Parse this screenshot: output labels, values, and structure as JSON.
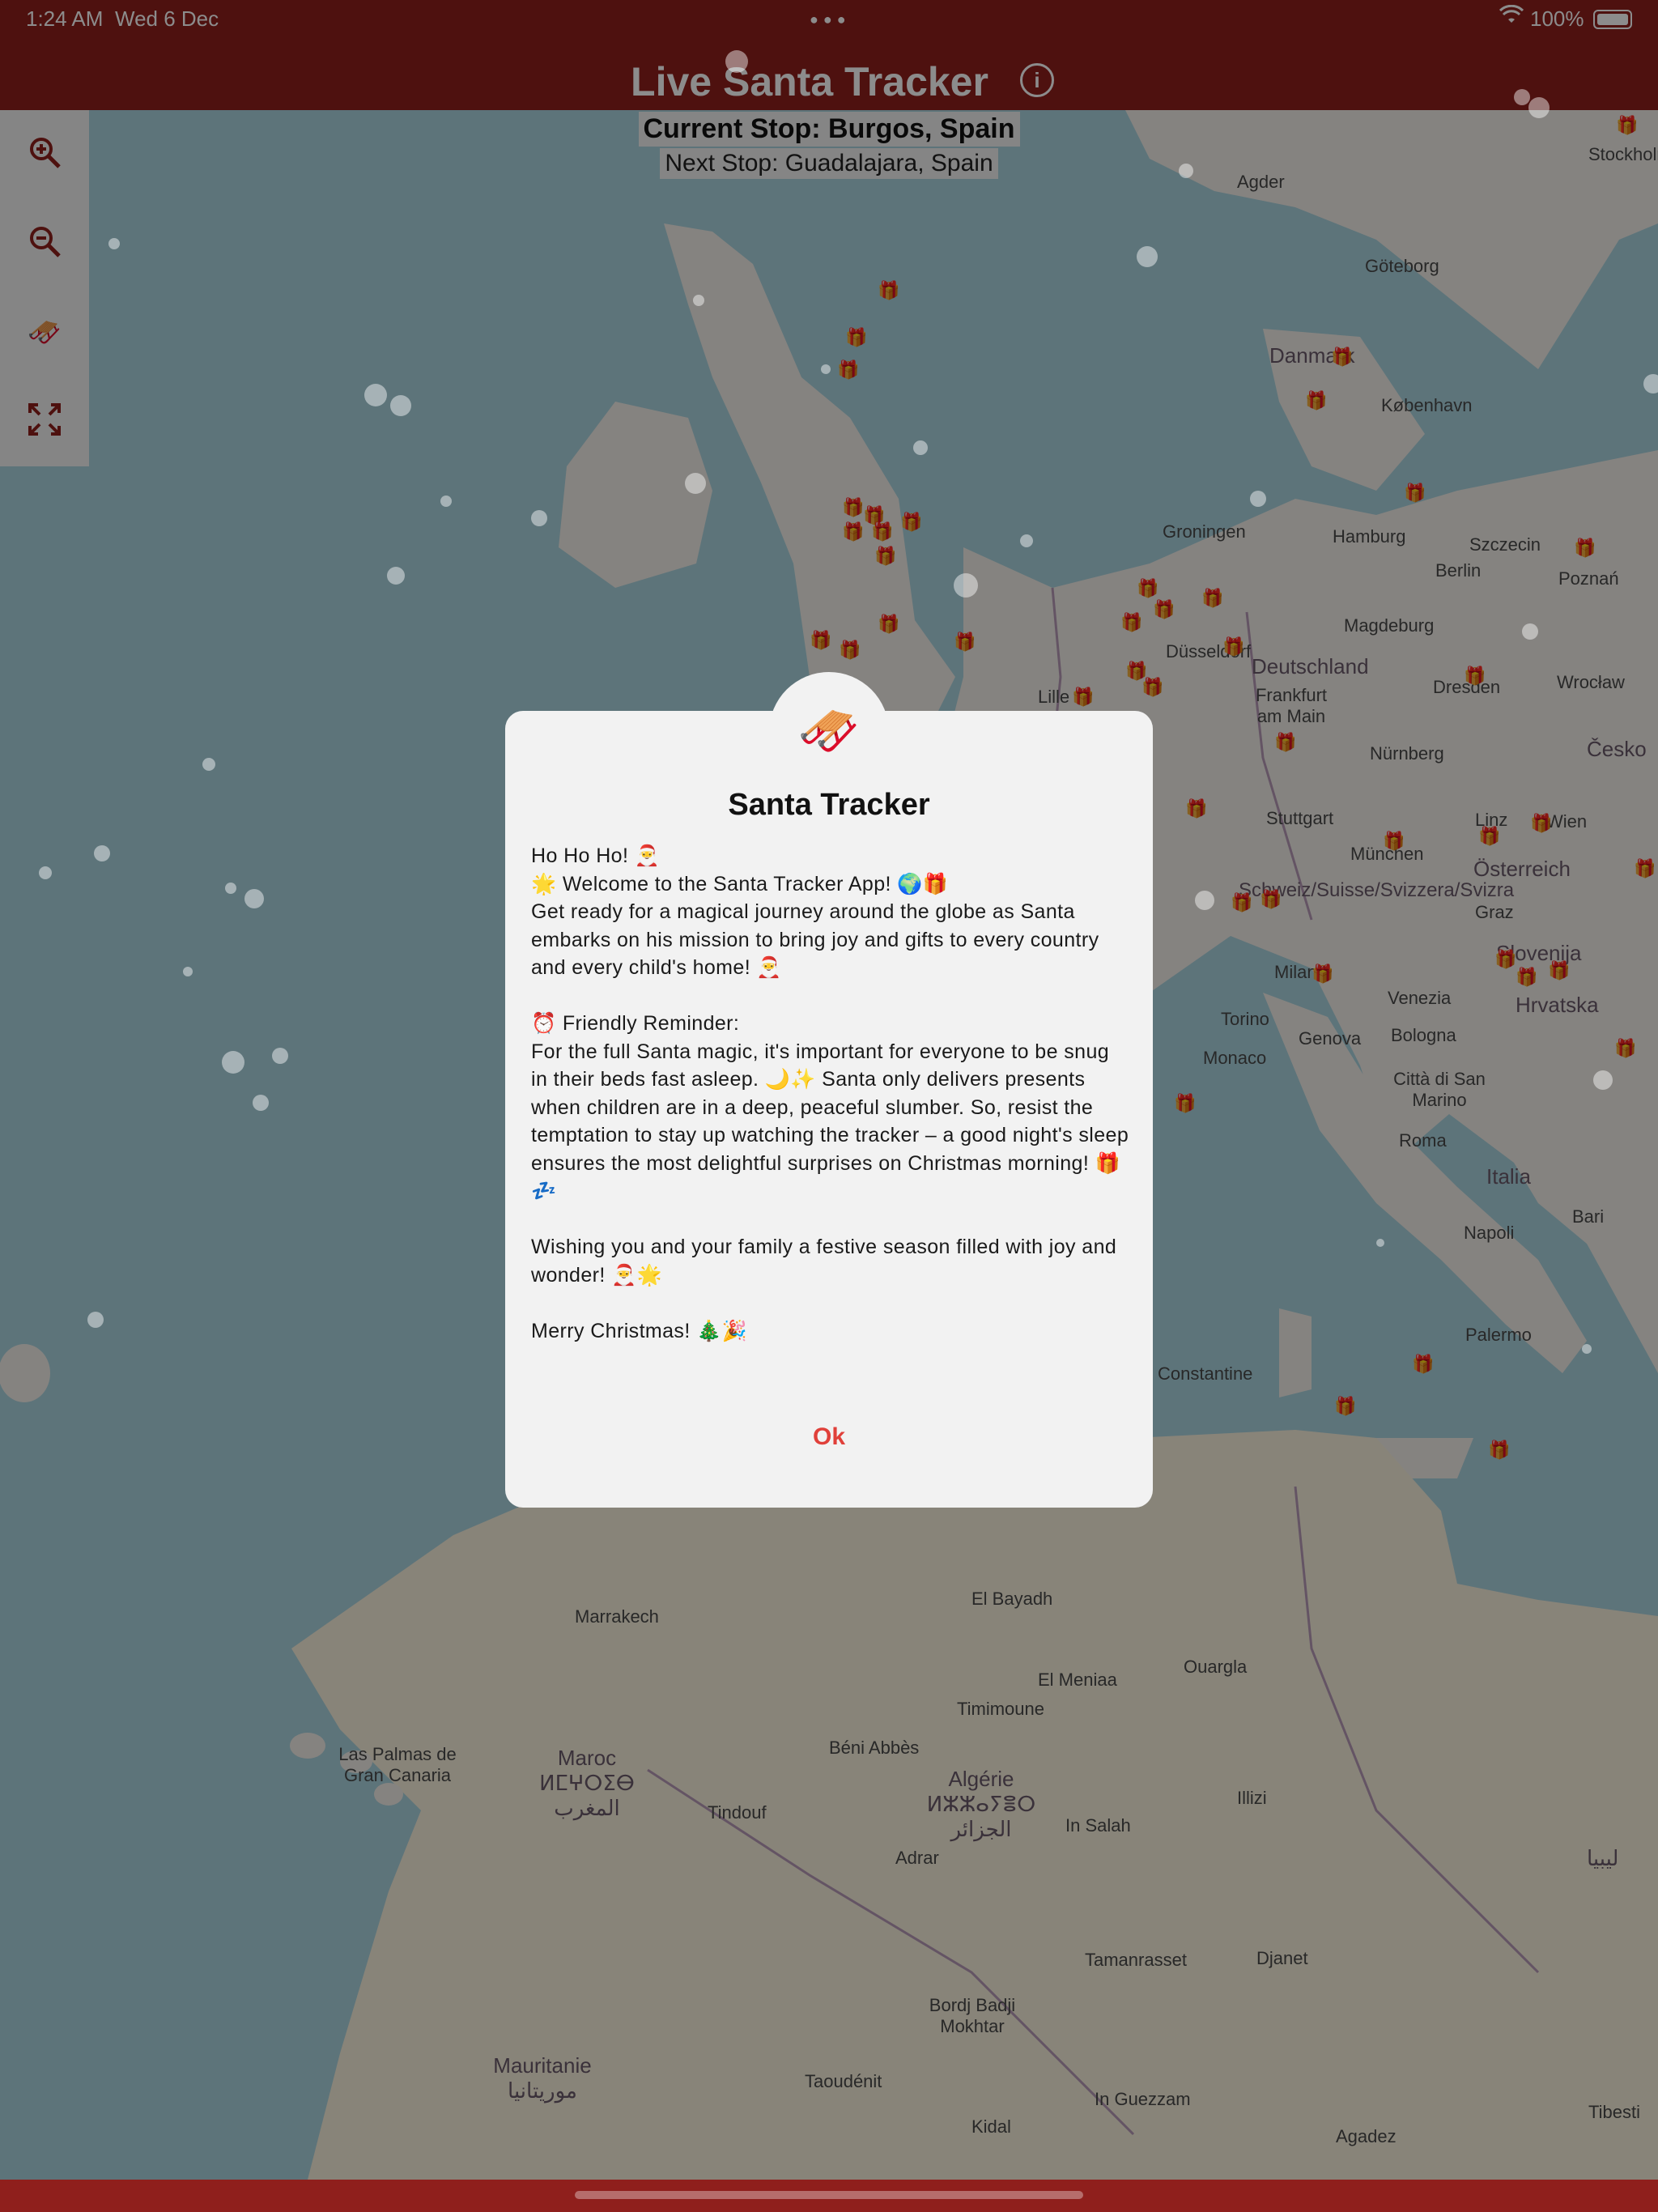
{
  "status_bar": {
    "time": "1:24 AM",
    "date": "Wed 6 Dec",
    "battery": "100%"
  },
  "header": {
    "title": "Live Santa Tracker"
  },
  "stops": {
    "current": "Current Stop: Burgos, Spain",
    "next": "Next Stop: Guadalajara, Spain"
  },
  "toolbar": {
    "zoom_in_icon": "zoom-in-icon",
    "zoom_out_icon": "zoom-out-icon",
    "santa_icon": "sleigh-icon",
    "fullscreen_icon": "fullscreen-icon"
  },
  "map": {
    "labels": [
      {
        "text": "Stockholm",
        "kind": "city"
      },
      {
        "text": "Göteborg",
        "kind": "city"
      },
      {
        "text": "Danmark",
        "kind": "country"
      },
      {
        "text": "København",
        "kind": "city"
      },
      {
        "text": "Hamburg",
        "kind": "city"
      },
      {
        "text": "Szczecin",
        "kind": "city"
      },
      {
        "text": "Berlin",
        "kind": "city"
      },
      {
        "text": "Poznań",
        "kind": "city"
      },
      {
        "text": "Groningen",
        "kind": "city"
      },
      {
        "text": "Magdeburg",
        "kind": "city"
      },
      {
        "text": "Deutschland",
        "kind": "country"
      },
      {
        "text": "Dresden",
        "kind": "city"
      },
      {
        "text": "Wrocław",
        "kind": "city"
      },
      {
        "text": "Düsseldorf",
        "kind": "city"
      },
      {
        "text": "Frankfurt am Main",
        "kind": "city"
      },
      {
        "text": "Česko",
        "kind": "country"
      },
      {
        "text": "Nürnberg",
        "kind": "city"
      },
      {
        "text": "Stuttgart",
        "kind": "city"
      },
      {
        "text": "München",
        "kind": "city"
      },
      {
        "text": "Linz",
        "kind": "city"
      },
      {
        "text": "Wien",
        "kind": "city"
      },
      {
        "text": "Österreich",
        "kind": "country"
      },
      {
        "text": "Graz",
        "kind": "city"
      },
      {
        "text": "Schweiz/Suisse/Svizzera/Svizra",
        "kind": "country"
      },
      {
        "text": "Milano",
        "kind": "city"
      },
      {
        "text": "Venezia",
        "kind": "city"
      },
      {
        "text": "Slovenija",
        "kind": "country"
      },
      {
        "text": "Hrvatska",
        "kind": "country"
      },
      {
        "text": "Torino",
        "kind": "city"
      },
      {
        "text": "Genova",
        "kind": "city"
      },
      {
        "text": "Bologna",
        "kind": "city"
      },
      {
        "text": "Monaco",
        "kind": "city"
      },
      {
        "text": "Città di San Marino",
        "kind": "city"
      },
      {
        "text": "Roma",
        "kind": "city"
      },
      {
        "text": "Italia",
        "kind": "country"
      },
      {
        "text": "Napoli",
        "kind": "city"
      },
      {
        "text": "Bari",
        "kind": "city"
      },
      {
        "text": "Palermo",
        "kind": "city"
      },
      {
        "text": "Constantine",
        "kind": "city"
      },
      {
        "text": "Marrakech",
        "kind": "city"
      },
      {
        "text": "El Bayadh",
        "kind": "city"
      },
      {
        "text": "Ouargla",
        "kind": "city"
      },
      {
        "text": "El Meniaa",
        "kind": "city"
      },
      {
        "text": "Timimoune",
        "kind": "city"
      },
      {
        "text": "Béni Abbès",
        "kind": "city"
      },
      {
        "text": "Las Palmas de Gran Canaria",
        "kind": "city"
      },
      {
        "text": "Maroc ⵍⵎⵖⵔⵉⴱ المغرب",
        "kind": "country"
      },
      {
        "text": "Algérie ⵍⵣⵣⴰⵢⴻⵔ الجزائر",
        "kind": "country"
      },
      {
        "text": "Tindouf",
        "kind": "city"
      },
      {
        "text": "Adrar",
        "kind": "city"
      },
      {
        "text": "In Salah",
        "kind": "city"
      },
      {
        "text": "Illizi",
        "kind": "city"
      },
      {
        "text": "Tamanrasset",
        "kind": "city"
      },
      {
        "text": "Djanet",
        "kind": "city"
      },
      {
        "text": "ليبيا",
        "kind": "country"
      },
      {
        "text": "Mauritanie موريتانيا",
        "kind": "country"
      },
      {
        "text": "Bordj Badji Mokhtar",
        "kind": "city"
      },
      {
        "text": "Taoudénit",
        "kind": "city"
      },
      {
        "text": "In Guezzam",
        "kind": "city"
      },
      {
        "text": "Kidal",
        "kind": "city"
      },
      {
        "text": "Agadez",
        "kind": "city"
      },
      {
        "text": "Tibesti",
        "kind": "city"
      },
      {
        "text": "Lille",
        "kind": "city"
      },
      {
        "text": "Agder",
        "kind": "city"
      }
    ]
  },
  "dialog": {
    "badge_icon": "santa-sleigh-icon",
    "title": "Santa Tracker",
    "lines": [
      "Ho Ho Ho! 🎅",
      "🌟 Welcome to the Santa Tracker App! 🌍🎁",
      "Get ready for a magical journey around the globe as Santa embarks on his mission to bring joy and gifts to every country and every child's home! 🎅",
      "",
      "⏰ Friendly Reminder:",
      "For the full Santa magic, it's important for everyone to be snug in their beds fast asleep. 🌙✨ Santa only delivers presents when children are in a deep, peaceful slumber. So, resist the temptation to stay up watching the tracker – a good night's sleep ensures the most delightful surprises on Christmas morning! 🎁💤",
      "",
      "Wishing you and your family a festive season filled with joy and wonder! 🎅🌟",
      "",
      "Merry Christmas! 🎄🎉"
    ],
    "ok_label": "Ok"
  },
  "colors": {
    "brand": "#8f1f1c",
    "ok_text": "#e0403a",
    "dialog_bg": "#f2f2f2"
  }
}
